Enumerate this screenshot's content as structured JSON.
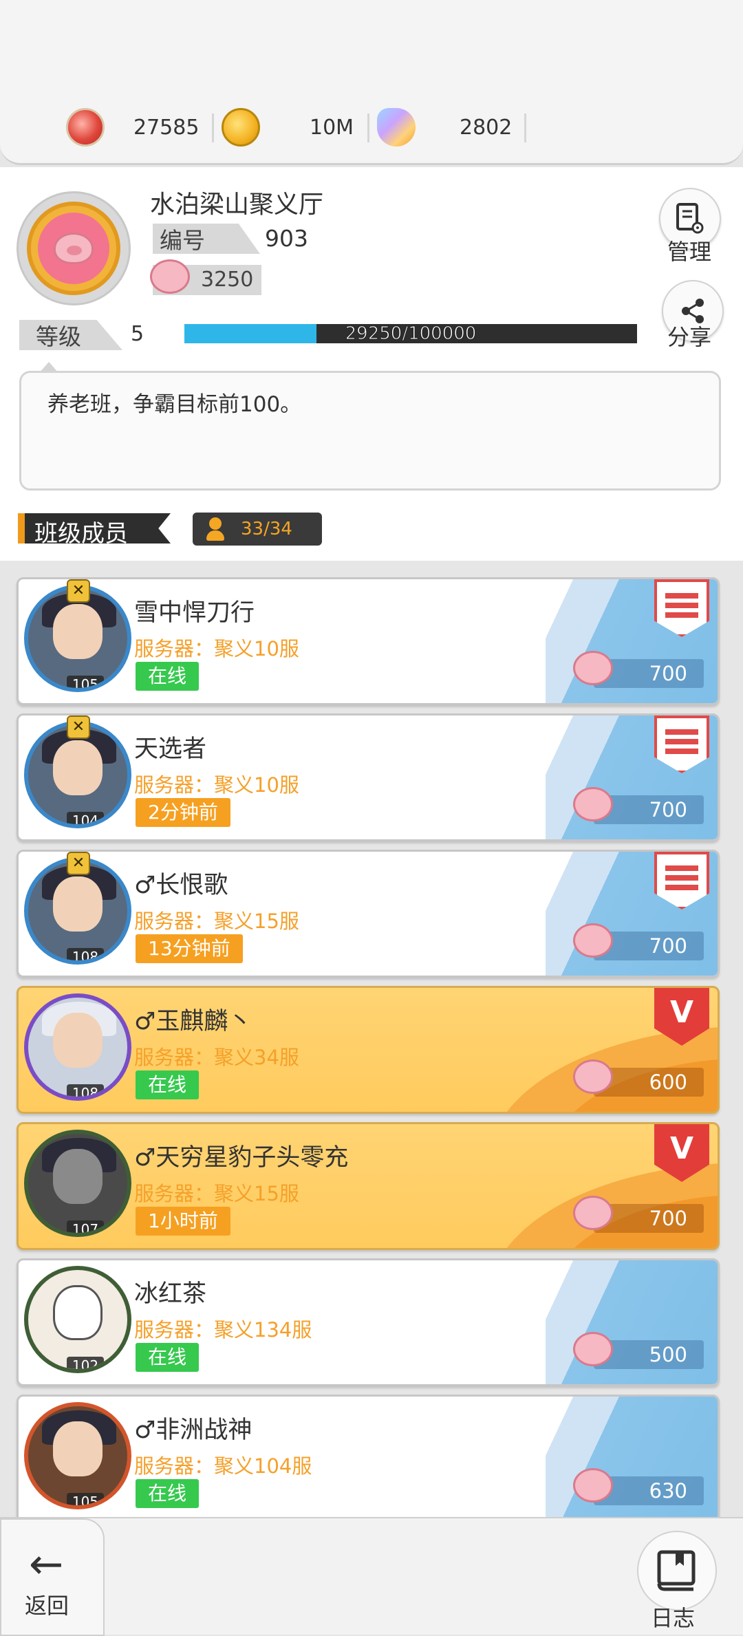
{
  "resources": [
    {
      "icon": "red-gem-icon",
      "value": "27585"
    },
    {
      "icon": "gold-coin-icon",
      "value": "10M"
    },
    {
      "icon": "crystal-bell-icon",
      "value": "2802"
    }
  ],
  "guild": {
    "name": "水泊梁山聚义厅",
    "id_label": "编号",
    "id_value": "903",
    "coins": "3250",
    "level_label": "等级",
    "level_value": "5",
    "xp_text": "29250/100000",
    "xp_fraction": 0.2925,
    "notice": "养老班，争霸目标前100。",
    "manage_label": "管理",
    "share_label": "分享"
  },
  "members_section": {
    "title": "班级成员",
    "count": "33/34"
  },
  "members": [
    {
      "name": "雪中悍刀行",
      "server": "服务器：聚义10服",
      "status": "在线",
      "status_type": "online",
      "level": "105",
      "contribution": "700",
      "rank_icon": "red-flag-badge-icon",
      "style": "normal"
    },
    {
      "name": "天选者",
      "server": "服务器：聚义10服",
      "status": "2分钟前",
      "status_type": "away",
      "level": "104",
      "contribution": "700",
      "rank_icon": "red-flag-badge-icon",
      "style": "normal"
    },
    {
      "name": "♂长恨歌",
      "server": "服务器：聚义15服",
      "status": "13分钟前",
      "status_type": "away",
      "level": "108",
      "contribution": "700",
      "rank_icon": "red-flag-badge-icon",
      "style": "normal"
    },
    {
      "name": "♂玉麒麟丶",
      "server": "服务器：聚义34服",
      "status": "在线",
      "status_type": "online",
      "level": "108",
      "contribution": "600",
      "rank_icon": "red-v-badge-icon",
      "style": "gold"
    },
    {
      "name": "♂天穷星豹子头零充",
      "server": "服务器：聚义15服",
      "status": "1小时前",
      "status_type": "away",
      "level": "107",
      "contribution": "700",
      "rank_icon": "red-v-badge-icon",
      "style": "gold"
    },
    {
      "name": "冰红茶",
      "server": "服务器：聚义134服",
      "status": "在线",
      "status_type": "online",
      "level": "102",
      "contribution": "500",
      "rank_icon": "",
      "style": "normal"
    },
    {
      "name": "♂非洲战神",
      "server": "服务器：聚义104服",
      "status": "在线",
      "status_type": "online",
      "level": "105",
      "contribution": "630",
      "rank_icon": "",
      "style": "normal"
    }
  ],
  "bottom": {
    "back_label": "返回",
    "log_label": "日志"
  }
}
